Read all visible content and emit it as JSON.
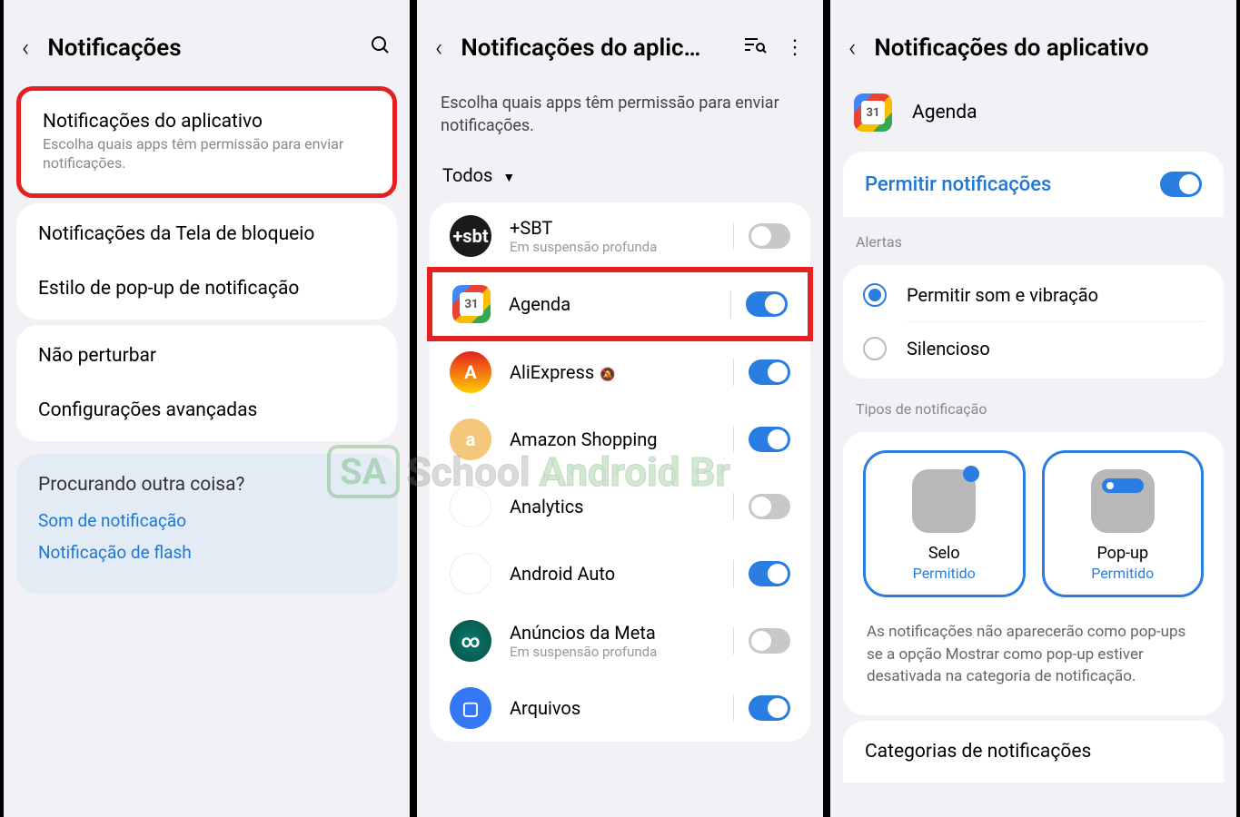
{
  "panel1": {
    "title": "Notificações",
    "card1": {
      "title": "Notificações do aplicativo",
      "subtitle": "Escolha quais apps têm permissão para enviar notificações."
    },
    "card2": {
      "row1": "Notificações da Tela de bloqueio",
      "row2": "Estilo de pop-up de notificação"
    },
    "card3": {
      "row1": "Não perturbar",
      "row2": "Configurações avançadas"
    },
    "tip": {
      "title": "Procurando outra coisa?",
      "link1": "Som de notificação",
      "link2": "Notificação de flash"
    }
  },
  "panel2": {
    "title": "Notificações do aplic…",
    "subtitle": "Escolha quais apps têm permissão para enviar notificações.",
    "dropdown": "Todos",
    "deepSleep": "Em suspensão profunda",
    "apps": [
      {
        "name": "+SBT",
        "muted": false,
        "deep": true,
        "on": false
      },
      {
        "name": "Agenda",
        "muted": false,
        "deep": false,
        "on": true,
        "highlight": true
      },
      {
        "name": "AliExpress",
        "muted": true,
        "deep": false,
        "on": true
      },
      {
        "name": "Amazon Shopping",
        "muted": false,
        "deep": false,
        "on": true
      },
      {
        "name": "Analytics",
        "muted": false,
        "deep": false,
        "on": false
      },
      {
        "name": "Android Auto",
        "muted": false,
        "deep": false,
        "on": true
      },
      {
        "name": "Anúncios da Meta",
        "muted": false,
        "deep": true,
        "on": false
      },
      {
        "name": "Arquivos",
        "muted": false,
        "deep": false,
        "on": true
      }
    ]
  },
  "panel3": {
    "title": "Notificações do aplicativo",
    "appName": "Agenda",
    "allowLabel": "Permitir notificações",
    "alertsLabel": "Alertas",
    "radio1": "Permitir som e vibração",
    "radio2": "Silencioso",
    "typesLabel": "Tipos de notificação",
    "type1": {
      "name": "Selo",
      "status": "Permitido"
    },
    "type2": {
      "name": "Pop-up",
      "status": "Permitido"
    },
    "infoText": "As notificações não aparecerão como pop-ups se a opção Mostrar como pop-up estiver desativada na categoria de notificação.",
    "categories": "Categorias de notificações"
  },
  "watermark": {
    "sa": "SA",
    "t1": "School",
    "t2": "Android Br"
  }
}
